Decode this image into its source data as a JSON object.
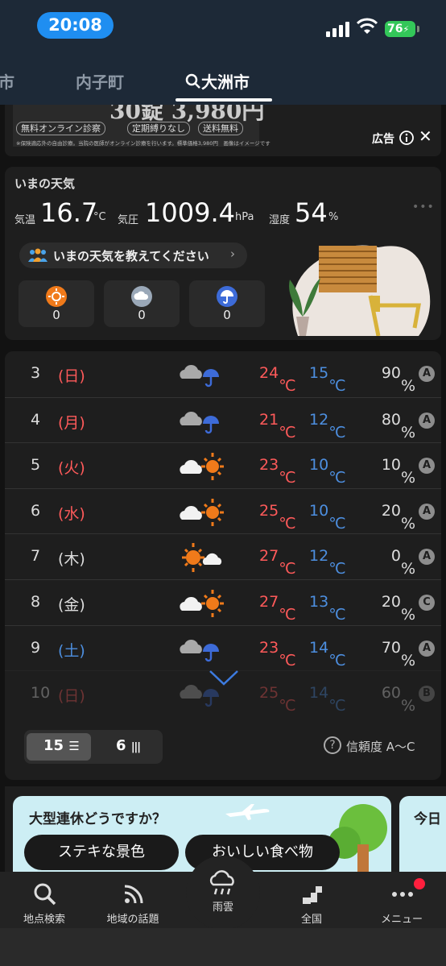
{
  "status_bar": {
    "time": "20:08",
    "battery": "76"
  },
  "tabs": [
    {
      "label": "市"
    },
    {
      "label": "内子町"
    },
    {
      "label": "大洲市",
      "active": true
    }
  ],
  "ad": {
    "big_text": "30錠 3,980円",
    "chips": [
      "無料オンライン診察",
      "定期縛りなし",
      "送料無料"
    ],
    "fine_print": "※保険適応外の自由診療。当院の医師がオンライン診療を行います。標準価格3,980円　画像はイメージです",
    "label": "広告"
  },
  "now": {
    "title": "いまの天気",
    "temp_label": "気温",
    "temp_value": "16.7",
    "temp_unit": "°C",
    "pressure_label": "気圧",
    "pressure_value": "1009.4",
    "pressure_unit": "hPa",
    "humidity_label": "湿度",
    "humidity_value": "54",
    "humidity_unit": "%",
    "report_prompt": "いまの天気を教えてください",
    "reports": [
      {
        "icon": "sun-icon",
        "count": "0",
        "color": "#f07a1a"
      },
      {
        "icon": "cloud-icon",
        "count": "0",
        "color": "#9aa8b8"
      },
      {
        "icon": "umbrella-icon",
        "count": "0",
        "color": "#3d6bd8"
      }
    ]
  },
  "forecast": {
    "unit_c": "℃",
    "rows": [
      {
        "day": "3",
        "dow": "(日)",
        "dow_color": "red",
        "icon": "cloud-rain-icon",
        "hi": "24",
        "lo": "15",
        "pop": "90%",
        "grade": "A"
      },
      {
        "day": "4",
        "dow": "(月)",
        "dow_color": "red",
        "icon": "cloud-rain-icon",
        "hi": "21",
        "lo": "12",
        "pop": "80%",
        "grade": "A"
      },
      {
        "day": "5",
        "dow": "(火)",
        "dow_color": "red",
        "icon": "cloud-sun-icon",
        "hi": "23",
        "lo": "10",
        "pop": "10%",
        "grade": "A"
      },
      {
        "day": "6",
        "dow": "(水)",
        "dow_color": "red",
        "icon": "cloud-sun-icon",
        "hi": "25",
        "lo": "10",
        "pop": "20%",
        "grade": "A"
      },
      {
        "day": "7",
        "dow": "(木)",
        "dow_color": "white",
        "icon": "sun-cloud-icon",
        "hi": "27",
        "lo": "12",
        "pop": "0%",
        "grade": "A"
      },
      {
        "day": "8",
        "dow": "(金)",
        "dow_color": "white",
        "icon": "cloud-sun-icon",
        "hi": "27",
        "lo": "13",
        "pop": "20%",
        "grade": "C"
      },
      {
        "day": "9",
        "dow": "(土)",
        "dow_color": "blue",
        "icon": "cloud-rain-icon",
        "hi": "23",
        "lo": "14",
        "pop": "70%",
        "grade": "A"
      },
      {
        "day": "10",
        "dow": "(日)",
        "dow_color": "red",
        "icon": "cloud-rain-icon",
        "hi": "25",
        "lo": "14",
        "pop": "60%",
        "grade": "B"
      }
    ],
    "toggle_15": "15",
    "toggle_6": "6",
    "reliability": "信頼度 A～C"
  },
  "holiday": {
    "title": "大型連休どうですか？",
    "buttons": [
      "ステキな景色",
      "おいしい食べ物"
    ],
    "next_title": "今日"
  },
  "bottom_nav": [
    {
      "label": "地点検索",
      "icon": "search-icon"
    },
    {
      "label": "地域の話題",
      "icon": "rss-icon"
    },
    {
      "label": "雨雲",
      "icon": "rain-cloud-icon"
    },
    {
      "label": "全国",
      "icon": "map-icon"
    },
    {
      "label": "メニュー",
      "icon": "more-icon"
    }
  ]
}
